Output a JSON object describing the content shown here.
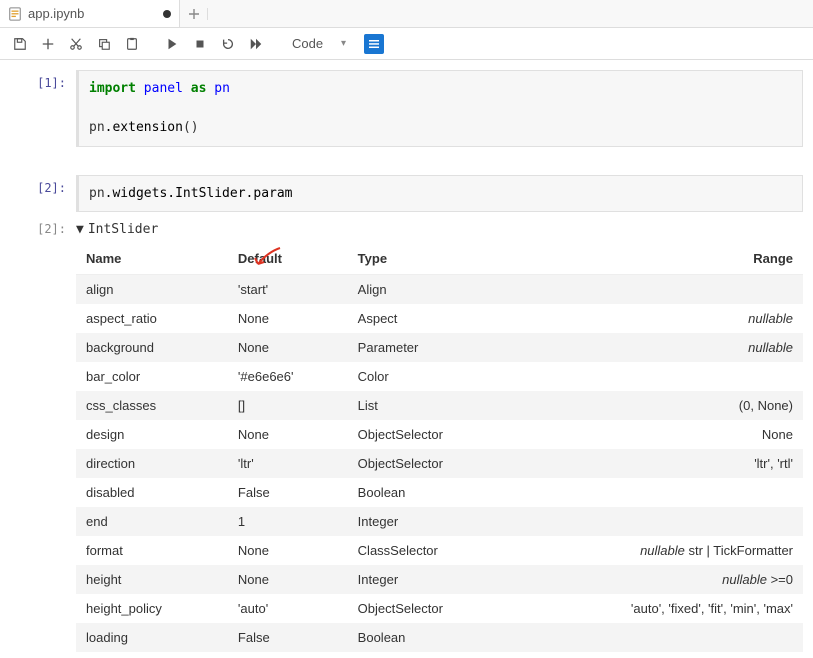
{
  "tab": {
    "name": "app.ipynb"
  },
  "toolbar": {
    "celltype": "Code"
  },
  "cells": {
    "c1": {
      "prompt": "[1]:",
      "code_html": "<span class='kw'>import</span> <span class='nm'>panel</span> <span class='kw'>as</span> <span class='nm'>pn</span>\n\npn<span class='fn'>.extension</span>()"
    },
    "c2": {
      "prompt": "[2]:",
      "code_html": "pn<span class='fn'>.widgets.IntSlider.param</span>"
    },
    "out2": {
      "prompt": "[2]:",
      "header": "IntSlider",
      "columns": [
        "Name",
        "Default",
        "Type",
        "Range"
      ],
      "rows": [
        {
          "name": "align",
          "default": "'start'",
          "type": "Align",
          "range": ""
        },
        {
          "name": "aspect_ratio",
          "default": "None",
          "type": "Aspect",
          "range": "<span class='italic'>nullable</span>"
        },
        {
          "name": "background",
          "default": "None",
          "type": "Parameter",
          "range": "<span class='italic'>nullable</span>"
        },
        {
          "name": "bar_color",
          "default": "'#e6e6e6'",
          "type": "Color",
          "range": ""
        },
        {
          "name": "css_classes",
          "default": "[]",
          "type": "List",
          "range": "(0, None)"
        },
        {
          "name": "design",
          "default": "None",
          "type": "ObjectSelector",
          "range": "None"
        },
        {
          "name": "direction",
          "default": "'ltr'",
          "type": "ObjectSelector",
          "range": "'ltr', 'rtl'"
        },
        {
          "name": "disabled",
          "default": "False",
          "type": "Boolean",
          "range": ""
        },
        {
          "name": "end",
          "default": "1",
          "type": "Integer",
          "range": ""
        },
        {
          "name": "format",
          "default": "None",
          "type": "ClassSelector",
          "range": "<span class='italic'>nullable</span> str | TickFormatter"
        },
        {
          "name": "height",
          "default": "None",
          "type": "Integer",
          "range": "<span class='italic'>nullable</span> >=0"
        },
        {
          "name": "height_policy",
          "default": "'auto'",
          "type": "ObjectSelector",
          "range": "'auto', 'fixed', 'fit', 'min', 'max'"
        },
        {
          "name": "loading",
          "default": "False",
          "type": "Boolean",
          "range": ""
        }
      ]
    }
  }
}
